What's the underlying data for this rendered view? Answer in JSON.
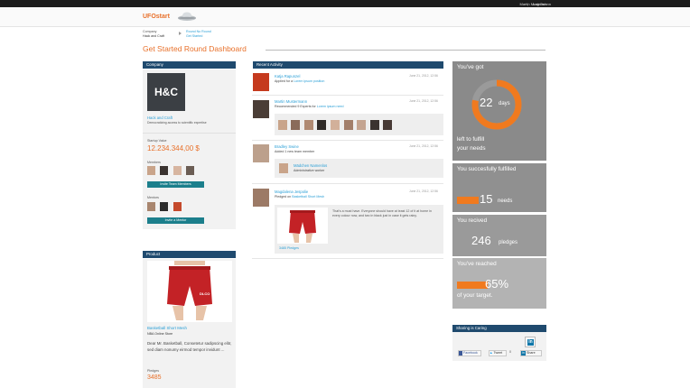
{
  "topbar": {
    "user": "Martin Mustermann",
    "separator": "|",
    "logout": "Log Out"
  },
  "header": {
    "logo": "UFOstart"
  },
  "breadcrumb": {
    "line1": "Company",
    "line2": "Hack and Craft",
    "current1": "Round No Round",
    "current2": "Get Started"
  },
  "page_title": "Get Started Round Dashboard",
  "company": {
    "heading": "Company",
    "logo_text": "H&C",
    "name": "Hack and Craft",
    "desc": "Democratizing access to scientific expertise",
    "valuation_label": "Startup Value",
    "valuation": "12.234.344,00 $",
    "members_label": "Members",
    "invite_members": "Invite Team Members",
    "mentors_label": "Mentors",
    "invite_mentor": "Invite a Mentor"
  },
  "product": {
    "heading": "Product",
    "name": "Basketball Short Mesh",
    "store": "NBA Online Store",
    "desc": "Dear Mr. Basketball, Consetetur sadipscing elitr, sed diam nonumy eirmod tempor invidunt ...",
    "pledges_label": "Pledges",
    "pledges": "3485",
    "shorts_text": "DLCO"
  },
  "activity": {
    "heading": "Recent Activity",
    "items": [
      {
        "name": "Katja Rapunzel",
        "text": "Applied for a ",
        "link": "Lorem ipsum position",
        "date": "June 21, 2012, 12:56"
      },
      {
        "name": "Martin Mustermann",
        "text": "Recommended 9 Experts for ",
        "link": "Lorem ipsum need",
        "date": "June 21, 2012, 12:56"
      },
      {
        "name": "Bradley Swine",
        "text": "Added 1 new team member",
        "link": "",
        "date": "June 21, 2012, 12:56",
        "sub_name": "Mädchen Namenlos",
        "sub_role": "Administrative worker"
      },
      {
        "name": "Magdalena Jespolie",
        "text": "Pledged on ",
        "link": "Basketball Short Mesh",
        "date": "June 21, 2012, 12:56",
        "body": "That's a must have. Everyone should have at least 12 of it at home in every colour now, and two in black just in case it gets rainy.",
        "pledges": "3485 Pledges"
      }
    ]
  },
  "stats": {
    "days_box": {
      "heading": "You've got",
      "days": "22",
      "days_unit": "days",
      "sub1": "left to fulfill",
      "sub2": "your needs",
      "progress": 0.78
    },
    "needs_box": {
      "heading": "You succesfully fulfilled",
      "num": "15",
      "unit": "needs"
    },
    "pledges_box": {
      "heading": "You recived",
      "num": "246",
      "unit": "pledges"
    },
    "target_box": {
      "heading": "You've reached",
      "num": "65%",
      "sub": "of your target."
    }
  },
  "sharing": {
    "heading": "Sharing is Caring",
    "facebook": "Facebook",
    "tweet": "Tweet",
    "tweet_count": "0",
    "share": "Share",
    "linkedin_icon": "in"
  },
  "colors": {
    "accent": "#e8702a",
    "panel_head": "#1f4a6e",
    "link": "#2a9fd6",
    "stat_gray": "#8b8b8b",
    "teal": "#1c7f8c"
  }
}
